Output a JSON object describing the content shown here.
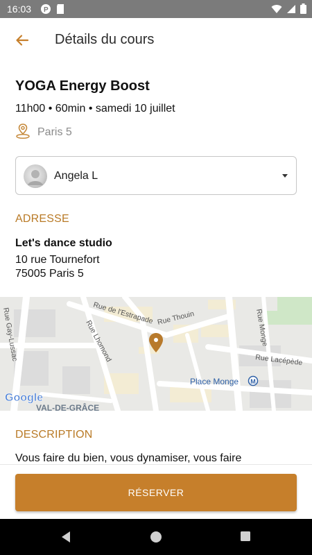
{
  "status_bar": {
    "time": "16:03"
  },
  "header": {
    "title": "Détails du cours"
  },
  "course": {
    "title": "YOGA Energy Boost",
    "meta": "11h00 • 60min • samedi 10 juillet",
    "location": "Paris 5"
  },
  "teacher_select": {
    "selected": "Angela L"
  },
  "address": {
    "section_label": "ADRESSE",
    "name": "Let's dance studio",
    "street": "10 rue Tournefort",
    "city": "75005 Paris 5"
  },
  "map": {
    "streets": [
      "Rue de l'Estrapade",
      "Rue Thouin",
      "Rue Lhomond",
      "Rue Gay-Lussac",
      "Rue Monge",
      "Rue Lacépède"
    ],
    "place": "Place Monge",
    "metro_symbol": "M",
    "district": "VAL-DE-GRÂCE",
    "provider": "Google"
  },
  "description": {
    "section_label": "DESCRIPTION",
    "text": "Vous faire du bien, vous dynamiser, vous faire"
  },
  "actions": {
    "reserve_label": "RÉSERVER"
  },
  "colors": {
    "accent": "#c67f2b",
    "section": "#b97a26",
    "status_bar": "#7b7b7b",
    "nav_bar": "#000000"
  },
  "icons": [
    "back-arrow-icon",
    "location-pin-icon",
    "dropdown-arrow-icon",
    "map-marker-icon",
    "metro-icon",
    "nav-back-icon",
    "nav-home-icon",
    "nav-recents-icon"
  ]
}
